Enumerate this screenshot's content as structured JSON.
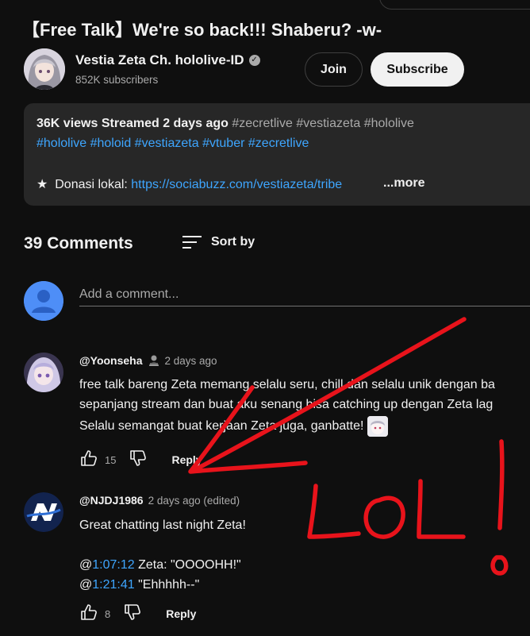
{
  "video": {
    "title": "【Free Talk】We're so back!!! Shaberu? -w-"
  },
  "channel": {
    "name": "Vestia Zeta Ch. hololive-ID",
    "subscribers": "852K subscribers",
    "join_label": "Join",
    "subscribe_label": "Subscribe",
    "verified_icon": "check-circle-icon"
  },
  "description": {
    "views": "36K views",
    "streamed": "Streamed 2 days ago",
    "tags_line1": [
      "#zecretlive",
      "#vestiazeta",
      "#hololive"
    ],
    "tags_line2": [
      "#hololive",
      "#holoid",
      "#vestiazeta",
      "#vtuber",
      "#zecretlive"
    ],
    "donation_label": "★  Donasi lokal: ",
    "donation_link": "https://sociabuzz.com/vestiazeta/tribe",
    "more_label": "...more"
  },
  "comments_section": {
    "count_label": "39 Comments",
    "sort_label": "Sort by",
    "sort_icon": "sort-icon",
    "add_placeholder": "Add a comment..."
  },
  "comments": [
    {
      "author": "@Yoonseha",
      "time": "2 days ago",
      "badge_icon": "member-badge-icon",
      "lines": [
        "free talk bareng Zeta memang selalu seru, chill dan selalu unik dengan ba",
        "sepanjang stream dan buat aku senang bisa catching up dengan Zeta lag",
        "Selalu semangat buat kerjaan Zeta juga, ganbatte! "
      ],
      "likes": "15",
      "reply_label": "Reply"
    },
    {
      "author": "@NJDJ1986",
      "time": "2 days ago (edited)",
      "lines": [
        "Great chatting last night Zeta!"
      ],
      "timestamps": [
        {
          "prefix": "@",
          "time": "1:07:12",
          "text": " Zeta: \"OOOOHH!\""
        },
        {
          "prefix": "@",
          "time": "1:21:41",
          "text": " \"Ehhhhh--\""
        }
      ],
      "likes": "8",
      "reply_label": "Reply"
    }
  ],
  "annotation": {
    "drawn_text": "LOL!",
    "color": "#e8131b"
  },
  "colors": {
    "background": "#0f0f0f",
    "panel": "#272727",
    "link": "#3ea6ff",
    "secondary_text": "#aaaaaa"
  }
}
